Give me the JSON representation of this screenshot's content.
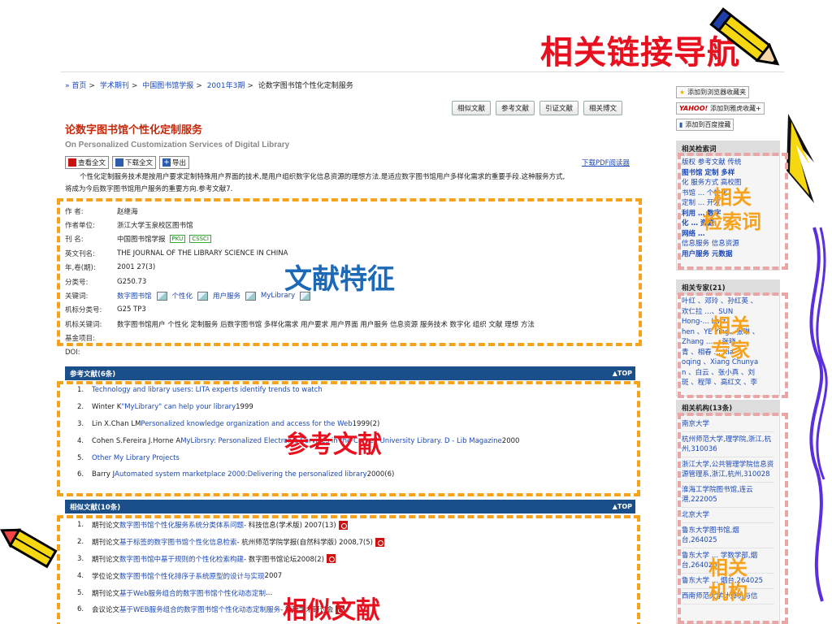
{
  "slide_title": "相关链接导航",
  "breadcrumb": {
    "items": [
      "首页",
      "学术期刊",
      "中国图书馆学报",
      "2001年3期",
      "论数字图书馆个性化定制服务"
    ]
  },
  "action_buttons": [
    "相似文献",
    "参考文献",
    "引证文献",
    "相关博文"
  ],
  "article": {
    "title": "论数字图书馆个性化定制服务",
    "title_en": "On Personalized Customization Services of Digital Library",
    "tools": [
      "查看全文",
      "下载全文",
      "导出"
    ],
    "pdf_reader": "下载PDF阅读器",
    "abstract_line1": "个性化定制服务技术是按用户要求定制特殊用户界面的技术,是用户组织数字化信息资源的理想方法.是适应数字图书馆用户多样化需求的重要手段.这种服务方式,",
    "abstract_line2": "将成为今后数字图书馆用户服务的重要方向.参考文献7."
  },
  "meta": {
    "author_label": "作 者:",
    "author": "赵继海",
    "unit_label": "作者单位:",
    "unit": "浙江大学玉泉校区图书馆",
    "journal_label": "刊 名:",
    "journal": "中国图书馆学报",
    "tag1": "PKU",
    "tag2": "CSSCI",
    "en_journal_label": "英文刊名:",
    "en_journal": "THE JOURNAL OF THE LIBRARY SCIENCE IN CHINA",
    "year_label": "年,卷(期):",
    "year": "2001 27(3)",
    "class_label": "分类号:",
    "class": "G250.73",
    "kw_label": "关键词:",
    "kw1": "数字图书馆",
    "kw2": "个性化",
    "kw3": "用户服务",
    "kw4": "MyLibrary",
    "mclass_label": "机标分类号:",
    "mclass": "G25 TP3",
    "mkw_label": "机标关键词:",
    "mkw": "数字图书馆用户 个性化 定制服务 后数字图书馆 多样化需求 用户要求 用户界面 用户服务 信息资源 服务技术 数字化 组织 文献 理想 方法",
    "fund_label": "基金项目:",
    "doi_label": "DOI:"
  },
  "overlays": {
    "features": "文献特征",
    "references": "参考文献",
    "similar": "相似文献",
    "related_terms_1": "相关",
    "related_terms_2": "检索词",
    "related_experts_1": "相关",
    "related_experts_2": "专家",
    "related_orgs_1": "相关",
    "related_orgs_2": "机构"
  },
  "references": {
    "header": "参考文献(6条)",
    "top": "▲TOP",
    "items": [
      {
        "num": "1.",
        "text": "Technology and library users: LITA experts identify trends to watch"
      },
      {
        "num": "2.",
        "author": "Winter K ",
        "title": "\"MyLibrary\" can help your library",
        "tail": " 1999"
      },
      {
        "num": "3.",
        "author": "Lin X.Chan LM ",
        "title": "Personalized knowledge organization and access for the Web",
        "tail": " 1999(2)"
      },
      {
        "num": "4.",
        "author": "Cohen S.Fereira J.Horne A ",
        "title": "MyLibrsry: Personalized Electronic Services in the Cornell University Library. D - Lib Magazine",
        "tail": " 2000"
      },
      {
        "num": "5.",
        "text": "Other My Library Projects"
      },
      {
        "num": "6.",
        "author": "Barry J ",
        "title": "Automated system marketplace 2000:Delivering the personalized library",
        "tail": " 2000(6)"
      }
    ]
  },
  "similar": {
    "header": "相似文献(10条)",
    "top": "▲TOP",
    "items": [
      {
        "num": "1.",
        "kind": "期刊论文 ",
        "title": "数字图书馆个性化服务系统分类体系问题",
        "tail": " - 科技信息(学术版) 2007(13)"
      },
      {
        "num": "2.",
        "kind": "期刊论文 ",
        "title": "基于标签的数字图书馆个性化信息检索",
        "tail": " - 杭州师范学院学报(自然科学版) 2008,7(5)"
      },
      {
        "num": "3.",
        "kind": "期刊论文 ",
        "title": "数字图书馆中基于规则的个性化检索构建",
        "tail": " - 数字图书馆论坛2008(2)"
      },
      {
        "num": "4.",
        "kind": "学位论文 ",
        "title": "数字图书馆个性化排序子系统原型的设计与实现",
        "tail": " 2007"
      },
      {
        "num": "5.",
        "kind": "期刊论文 ",
        "title": "基于Web服务组合的数字图书馆个性化动态定制",
        "tail": " ..."
      },
      {
        "num": "6.",
        "kind": "会议论文 ",
        "title": "基于WEB服务组合的数字图书馆个性化动态定制服务",
        "tail": " - 管理学术研讨会"
      }
    ]
  },
  "sidebar": {
    "fav_browser": "添加到浏览器收藏夹",
    "yahoo": "YAHOO!",
    "fav_yahoo": "添加到雅虎收藏+",
    "fav_baidu": "添加到百度搜藏",
    "terms_head": "相关检索词",
    "terms_lines": [
      "版权 参考文献 传统",
      "图书馆 定制 多样",
      "化 服务方式 高校图",
      "书馆 … 个性化",
      "定制 … 开发",
      "利用 … 数字",
      "化 … 资源",
      "网络 …",
      "信息服务 信息资源",
      "用户服务 元数据"
    ],
    "experts_head": "相关专家(21)",
    "experts_lines": [
      "叶红 、邓玲 、孙红英 、",
      "欢仁拉 …、SUN",
      "Hong-… La-z",
      "hen 、YE Ying、张琳 、",
      "Zhang … 、张晓",
      "青 、相春 … Xia",
      "oqing 、Xiang Chunya",
      "n 、白云 、张小真 、刘",
      "斑 、程萍 、高红文 、李",
      "…"
    ],
    "orgs_head": "相关机构(13条)",
    "orgs": [
      "南京大学",
      "杭州师范大学,理学院,浙江,杭州,310036",
      "浙江大学,公共管理学院信息资源管理系,浙江,杭州,310028",
      "淮海工学院图书馆,连云港,222005",
      "北京大学",
      "鲁东大学图书馆,烟台,264025",
      "鲁东大学 … 学数学部,烟台,264025",
      "鲁东大学 … 烟台,264025",
      "西南师范大学计算机与信"
    ]
  },
  "colors": {
    "accent_red": "#e8101e",
    "dashed_orange": "#f7a21b",
    "dashed_pink": "#e8a6a6",
    "link_blue": "#1c48b8",
    "header_blue": "#1a4f8a"
  }
}
